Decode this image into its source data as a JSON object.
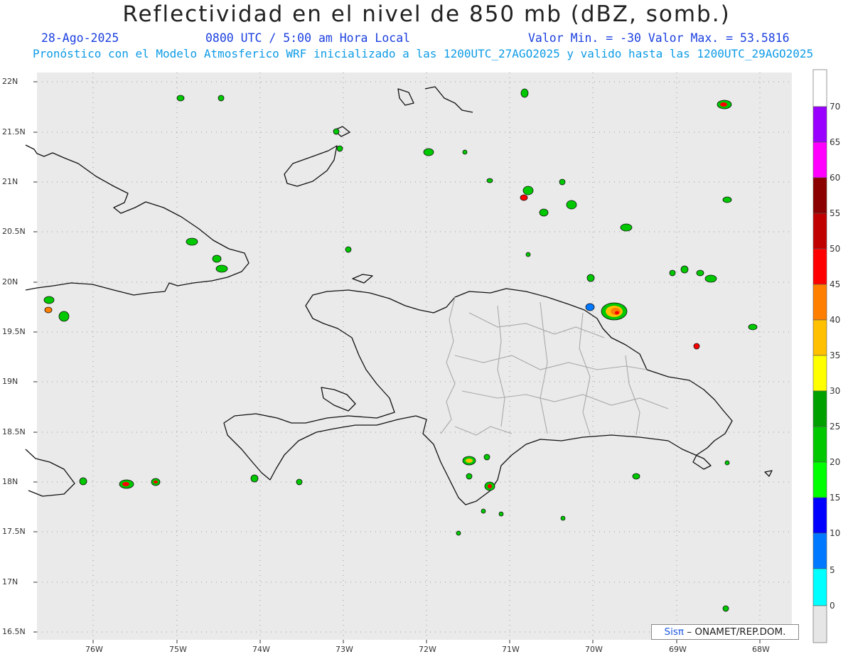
{
  "header": {
    "title": "Reflectividad en el nivel de 850 mb (dBZ, somb.)",
    "date": "28-Ago-2025",
    "time": "0800 UTC / 5:00 am Hora Local",
    "value_range": "Valor Min. = -30  Valor Max. = 53.5816",
    "model_info": "Pronóstico con el Modelo Atmosferico WRF inicializado a las 1200UTC_27AGO2025 y valido hasta las  1200UTC_29AGO2025"
  },
  "axes": {
    "y_labels": [
      "22N",
      "21.5N",
      "21N",
      "20.5N",
      "20N",
      "19.5N",
      "19N",
      "18.5N",
      "18N",
      "17.5N",
      "17N",
      "16.5N"
    ],
    "x_labels": [
      "76W",
      "75W",
      "74W",
      "73W",
      "72W",
      "71W",
      "70W",
      "69W",
      "68W"
    ]
  },
  "colorbar": {
    "labels": [
      "70",
      "65",
      "60",
      "55",
      "50",
      "45",
      "40",
      "35",
      "30",
      "25",
      "20",
      "15",
      "10",
      "5",
      "0"
    ],
    "colors": [
      "#9a00ff",
      "#ff00ff",
      "#8b0000",
      "#c00000",
      "#ff0000",
      "#ff7f00",
      "#ffc000",
      "#ffff00",
      "#00a000",
      "#00c800",
      "#00ff00",
      "#0000ff",
      "#0078ff",
      "#00b4ff",
      "#00ffff",
      "#e6e6e6"
    ]
  },
  "credit": {
    "brand": "Sisπ",
    "text": "– ONAMET/REP.DOM."
  },
  "style": {
    "map_bg": "#eaeaea",
    "title_color": "#1b3fe0",
    "subtitle_color": "#0d9be6"
  }
}
